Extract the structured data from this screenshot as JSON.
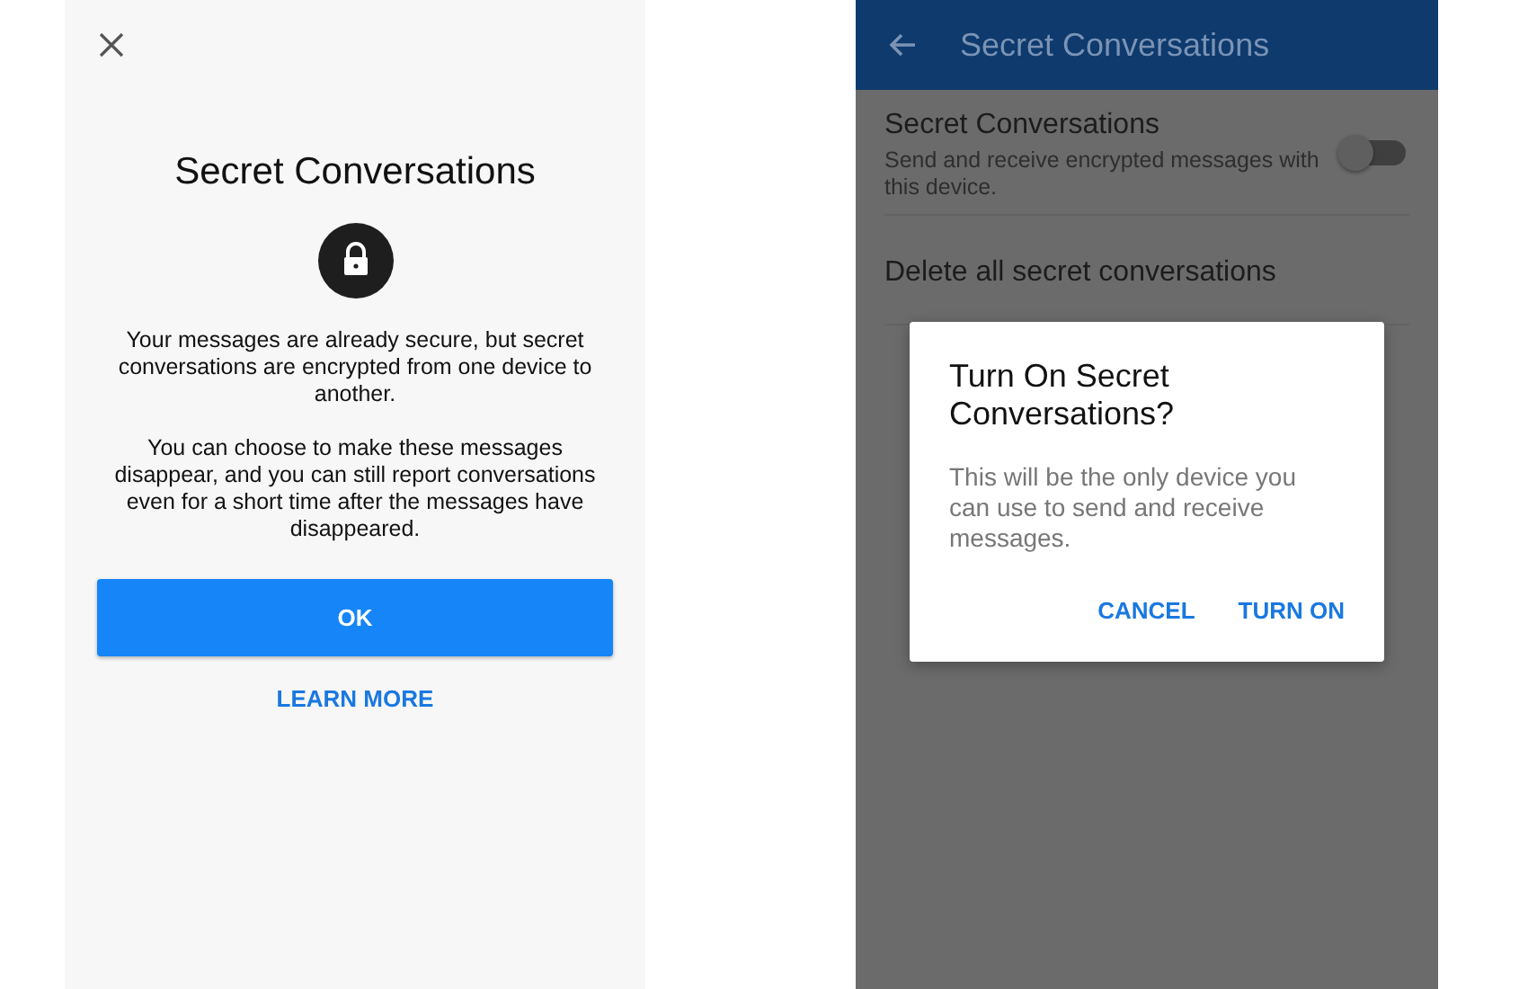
{
  "intro_screen": {
    "title": "Secret Conversations",
    "paragraphs": [
      "Your messages are already secure, but secret conversations are encrypted from one device to another.",
      "You can choose to make these messages disappear, and you can still report conversations even for a short time after the messages have disappeared."
    ],
    "primary_button": "OK",
    "link_button": "LEARN MORE"
  },
  "settings_screen": {
    "header": {
      "title": "Secret Conversations"
    },
    "settings": [
      {
        "kind": "toggle",
        "title": "Secret Conversations",
        "subtitle": "Send and receive encrypted messages with this device.",
        "on": false
      },
      {
        "kind": "action",
        "title": "Delete all secret conversations"
      }
    ],
    "dialog": {
      "title": "Turn On Secret Conversations?",
      "message": "This will be the only device you can use to send and receive messages.",
      "buttons": [
        "CANCEL",
        "TURN ON"
      ]
    }
  }
}
